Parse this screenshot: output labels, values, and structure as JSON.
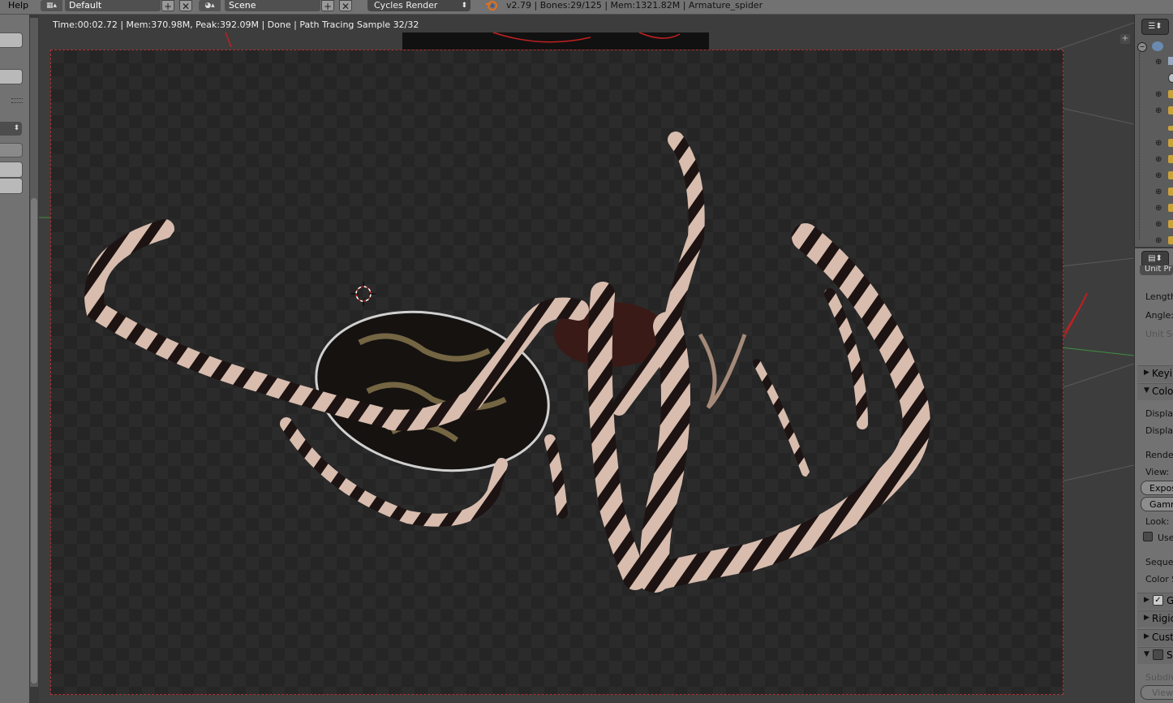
{
  "topbar": {
    "help_menu": "Help",
    "screen_layout": "Default",
    "scene": "Scene",
    "render_engine": "Cycles Render",
    "stats": "v2.79 | Bones:29/125 | Mem:1321.82M | Armature_spider"
  },
  "viewport": {
    "render_status": "Time:00:02.72 | Mem:370.98M, Peak:392.09M | Done | Path Tracing Sample 32/32",
    "render_subject": "Armature_spider"
  },
  "outliner": {
    "rows": 13
  },
  "properties": {
    "unit_tab": "Unit Pr",
    "length": "Length",
    "angle": "Angle:",
    "unit_scale": "Unit Sc",
    "keying_panel": "Keyi",
    "color_panel": "Colo",
    "display_1": "Display",
    "display_2": "Display",
    "render_label": "Render",
    "view_label": "View:",
    "exposure": "Expos",
    "gamma": "Gamr",
    "look_label": "Look:",
    "use_curves": "Use",
    "sequencer_label": "Sequen",
    "color_space": "Color S",
    "gravity_panel": "G",
    "rigid_panel": "Rigic",
    "custom_panel": "Cust",
    "simplify_panel": "S",
    "subdiv_label": "Subdiv",
    "viewport_label": "View"
  }
}
